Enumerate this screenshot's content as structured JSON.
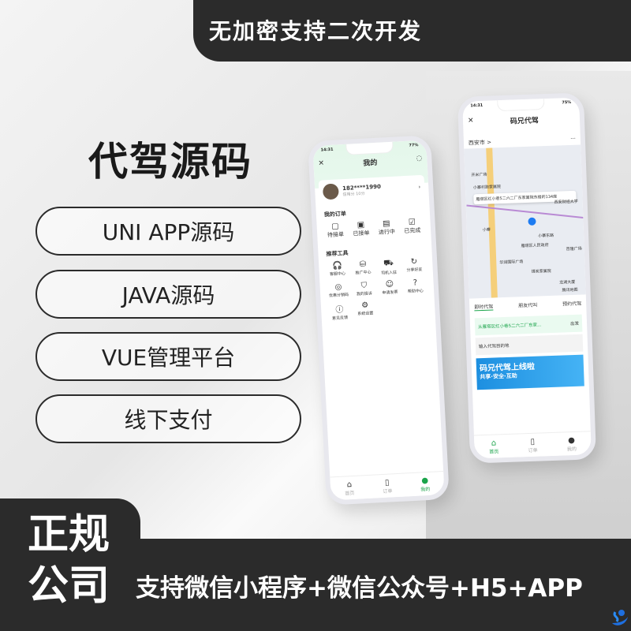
{
  "top_banner": "无加密支持二次开发",
  "title": "代驾源码",
  "features": [
    "UNI APP源码",
    "JAVA源码",
    "VUE管理平台",
    "线下支付"
  ],
  "bottom": {
    "line1": "正规",
    "line2": "公司",
    "support": "支持微信小程序+微信公众号+H5+APP"
  },
  "colors": {
    "dark": "#2b2b2b",
    "accent_green": "#1aa44a",
    "banner_blue": "#1d8fe0"
  },
  "phone_left": {
    "time": "14:31",
    "battery": "77%",
    "title": "我的",
    "phone": "182****1990",
    "sub": "信用分 10分",
    "orders_title": "我的订单",
    "orders": [
      "待接单",
      "已接单",
      "进行中",
      "已完成"
    ],
    "tools_title": "推荐工具",
    "tools": [
      "客服中心",
      "推广中心",
      "司机入驻",
      "分享好友",
      "优惠分销码",
      "我的投诉",
      "申请发票",
      "帮助中心",
      "意见反馈",
      "系统设置"
    ],
    "tabs": [
      "首页",
      "订单",
      "我的"
    ]
  },
  "phone_right": {
    "time": "14:31",
    "battery": "75%",
    "title": "码兄代驾",
    "city": "西安市 >",
    "bubble": "雁塔区红小巷5二六二厂东家属院东楼的134座",
    "map_labels": [
      "开米广场",
      "小寨村跑家属院",
      "小寨",
      "小寨东路",
      "雁塔区人民政府",
      "百隆广场",
      "华润国际广场",
      "煤炭家属院",
      "西安财经大学",
      "龙湖大厦",
      "腾讯地图"
    ],
    "tabs_mode": [
      "即时代驾",
      "朋友代叫",
      "预约代驾"
    ],
    "from": "从雁塔区红小巷5二六二厂东家...",
    "from_suffix": "出发",
    "to": "输入代驾目的地",
    "banner": "码兄代驾上线啦",
    "banner_sub": "共享·安全·互助",
    "tabs": [
      "首页",
      "订单",
      "我的"
    ]
  }
}
